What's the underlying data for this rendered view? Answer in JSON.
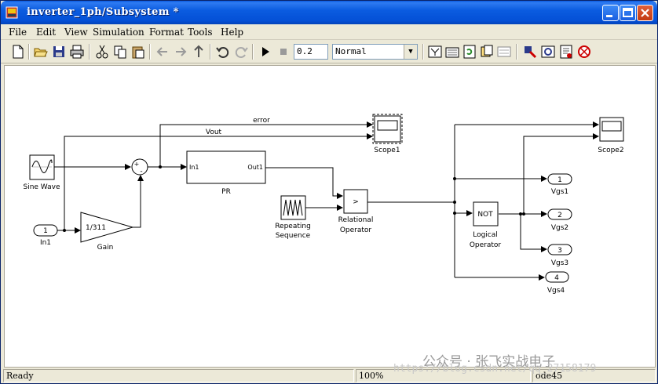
{
  "window": {
    "title": "inverter_1ph/Subsystem *"
  },
  "menu": [
    "File",
    "Edit",
    "View",
    "Simulation",
    "Format",
    "Tools",
    "Help"
  ],
  "toolbar": {
    "stop_time": "0.2",
    "sim_mode": "Normal"
  },
  "diagram": {
    "blocks": {
      "sine": "Sine Wave",
      "in1_port": "1",
      "in1_label": "In1",
      "gain_value": "1/311",
      "gain_label": "Gain",
      "sum_plus": "+",
      "sum_minus": "-",
      "pr_in": "In1",
      "pr_out": "Out1",
      "pr_label": "PR",
      "repeating_line1": "Repeating",
      "repeating_line2": "Sequence",
      "relop_symbol": ">",
      "relop_line1": "Relational",
      "relop_line2": "Operator",
      "not_symbol": "NOT",
      "logical_line1": "Logical",
      "logical_line2": "Operator",
      "scope1": "Scope1",
      "scope2": "Scope2",
      "vgs1_port": "1",
      "vgs1_label": "Vgs1",
      "vgs2_port": "2",
      "vgs2_label": "Vgs2",
      "vgs3_port": "3",
      "vgs3_label": "Vgs3",
      "vgs4_port": "4",
      "vgs4_label": "Vgs4"
    },
    "signals": {
      "error": "error",
      "vout": "Vout"
    }
  },
  "status": {
    "left": "Ready",
    "zoom": "100%",
    "solver": "ode45"
  },
  "watermark": "公众号 · 张飞实战电子",
  "watermark_url": "https://blog.csdn.net/qq_27158179"
}
